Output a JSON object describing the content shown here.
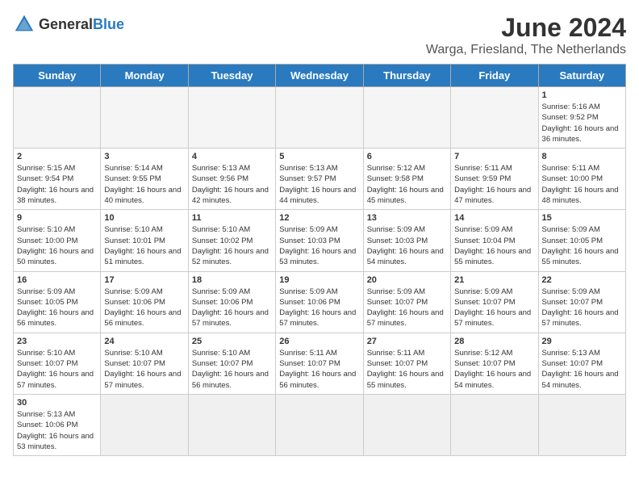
{
  "logo": {
    "general": "General",
    "blue": "Blue"
  },
  "title": "June 2024",
  "location": "Warga, Friesland, The Netherlands",
  "days_of_week": [
    "Sunday",
    "Monday",
    "Tuesday",
    "Wednesday",
    "Thursday",
    "Friday",
    "Saturday"
  ],
  "weeks": [
    [
      {
        "day": "",
        "info": ""
      },
      {
        "day": "",
        "info": ""
      },
      {
        "day": "",
        "info": ""
      },
      {
        "day": "",
        "info": ""
      },
      {
        "day": "",
        "info": ""
      },
      {
        "day": "",
        "info": ""
      },
      {
        "day": "1",
        "info": "Sunrise: 5:16 AM\nSunset: 9:52 PM\nDaylight: 16 hours and 36 minutes."
      }
    ],
    [
      {
        "day": "2",
        "info": "Sunrise: 5:15 AM\nSunset: 9:54 PM\nDaylight: 16 hours and 38 minutes."
      },
      {
        "day": "3",
        "info": "Sunrise: 5:14 AM\nSunset: 9:55 PM\nDaylight: 16 hours and 40 minutes."
      },
      {
        "day": "4",
        "info": "Sunrise: 5:13 AM\nSunset: 9:56 PM\nDaylight: 16 hours and 42 minutes."
      },
      {
        "day": "5",
        "info": "Sunrise: 5:13 AM\nSunset: 9:57 PM\nDaylight: 16 hours and 44 minutes."
      },
      {
        "day": "6",
        "info": "Sunrise: 5:12 AM\nSunset: 9:58 PM\nDaylight: 16 hours and 45 minutes."
      },
      {
        "day": "7",
        "info": "Sunrise: 5:11 AM\nSunset: 9:59 PM\nDaylight: 16 hours and 47 minutes."
      },
      {
        "day": "8",
        "info": "Sunrise: 5:11 AM\nSunset: 10:00 PM\nDaylight: 16 hours and 48 minutes."
      }
    ],
    [
      {
        "day": "9",
        "info": "Sunrise: 5:10 AM\nSunset: 10:00 PM\nDaylight: 16 hours and 50 minutes."
      },
      {
        "day": "10",
        "info": "Sunrise: 5:10 AM\nSunset: 10:01 PM\nDaylight: 16 hours and 51 minutes."
      },
      {
        "day": "11",
        "info": "Sunrise: 5:10 AM\nSunset: 10:02 PM\nDaylight: 16 hours and 52 minutes."
      },
      {
        "day": "12",
        "info": "Sunrise: 5:09 AM\nSunset: 10:03 PM\nDaylight: 16 hours and 53 minutes."
      },
      {
        "day": "13",
        "info": "Sunrise: 5:09 AM\nSunset: 10:03 PM\nDaylight: 16 hours and 54 minutes."
      },
      {
        "day": "14",
        "info": "Sunrise: 5:09 AM\nSunset: 10:04 PM\nDaylight: 16 hours and 55 minutes."
      },
      {
        "day": "15",
        "info": "Sunrise: 5:09 AM\nSunset: 10:05 PM\nDaylight: 16 hours and 55 minutes."
      }
    ],
    [
      {
        "day": "16",
        "info": "Sunrise: 5:09 AM\nSunset: 10:05 PM\nDaylight: 16 hours and 56 minutes."
      },
      {
        "day": "17",
        "info": "Sunrise: 5:09 AM\nSunset: 10:06 PM\nDaylight: 16 hours and 56 minutes."
      },
      {
        "day": "18",
        "info": "Sunrise: 5:09 AM\nSunset: 10:06 PM\nDaylight: 16 hours and 57 minutes."
      },
      {
        "day": "19",
        "info": "Sunrise: 5:09 AM\nSunset: 10:06 PM\nDaylight: 16 hours and 57 minutes."
      },
      {
        "day": "20",
        "info": "Sunrise: 5:09 AM\nSunset: 10:07 PM\nDaylight: 16 hours and 57 minutes."
      },
      {
        "day": "21",
        "info": "Sunrise: 5:09 AM\nSunset: 10:07 PM\nDaylight: 16 hours and 57 minutes."
      },
      {
        "day": "22",
        "info": "Sunrise: 5:09 AM\nSunset: 10:07 PM\nDaylight: 16 hours and 57 minutes."
      }
    ],
    [
      {
        "day": "23",
        "info": "Sunrise: 5:10 AM\nSunset: 10:07 PM\nDaylight: 16 hours and 57 minutes."
      },
      {
        "day": "24",
        "info": "Sunrise: 5:10 AM\nSunset: 10:07 PM\nDaylight: 16 hours and 57 minutes."
      },
      {
        "day": "25",
        "info": "Sunrise: 5:10 AM\nSunset: 10:07 PM\nDaylight: 16 hours and 56 minutes."
      },
      {
        "day": "26",
        "info": "Sunrise: 5:11 AM\nSunset: 10:07 PM\nDaylight: 16 hours and 56 minutes."
      },
      {
        "day": "27",
        "info": "Sunrise: 5:11 AM\nSunset: 10:07 PM\nDaylight: 16 hours and 55 minutes."
      },
      {
        "day": "28",
        "info": "Sunrise: 5:12 AM\nSunset: 10:07 PM\nDaylight: 16 hours and 54 minutes."
      },
      {
        "day": "29",
        "info": "Sunrise: 5:13 AM\nSunset: 10:07 PM\nDaylight: 16 hours and 54 minutes."
      }
    ],
    [
      {
        "day": "30",
        "info": "Sunrise: 5:13 AM\nSunset: 10:06 PM\nDaylight: 16 hours and 53 minutes."
      },
      {
        "day": "",
        "info": ""
      },
      {
        "day": "",
        "info": ""
      },
      {
        "day": "",
        "info": ""
      },
      {
        "day": "",
        "info": ""
      },
      {
        "day": "",
        "info": ""
      },
      {
        "day": "",
        "info": ""
      }
    ]
  ]
}
